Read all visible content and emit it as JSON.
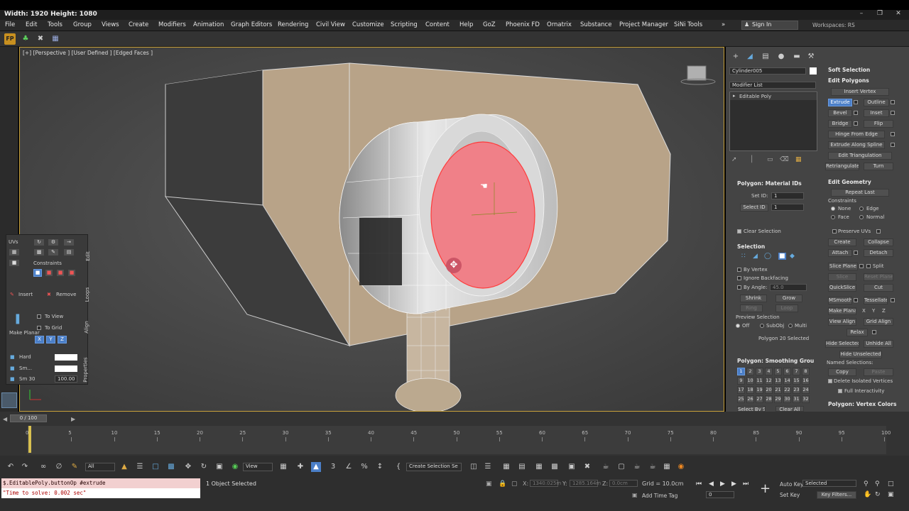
{
  "title_overlay": "Width: 1920  Height: 1080",
  "menu": [
    "File",
    "Edit",
    "Tools",
    "Group",
    "Views",
    "Create",
    "Modifiers",
    "Animation",
    "Graph Editors",
    "Rendering",
    "Civil View",
    "Customize",
    "Scripting",
    "Content",
    "Help",
    "GoZ",
    "Phoenix FD",
    "Ornatrix",
    "Substance",
    "Project Manager",
    "SiNi Tools"
  ],
  "sign_in": "Sign In",
  "workspaces": "Workspaces: RS",
  "viewport_label": "[+] [Perspective ] [User Defined ] [Edged Faces ]",
  "object_name": "Cylinder005",
  "modifier_list": "Modifier List",
  "modifier_stack_item": "Editable Poly",
  "panels": {
    "soft_selection": "Soft Selection",
    "edit_polygons": "Edit Polygons",
    "insert_vertex": "Insert Vertex",
    "extrude": "Extrude",
    "outline": "Outline",
    "bevel": "Bevel",
    "inset": "Inset",
    "bridge": "Bridge",
    "flip": "Flip",
    "hinge": "Hinge From Edge",
    "extrude_spline": "Extrude Along Spline",
    "edit_triangulation": "Edit Triangulation",
    "retriangulate": "Retriangulate",
    "turn": "Turn",
    "edit_geometry": "Edit Geometry",
    "repeat_last": "Repeat Last",
    "constraints": "Constraints",
    "none": "None",
    "edge": "Edge",
    "face": "Face",
    "normal": "Normal",
    "preserve_uvs": "Preserve UVs",
    "create": "Create",
    "collapse": "Collapse",
    "attach": "Attach",
    "detach": "Detach",
    "slice_plane": "Slice Plane",
    "split": "Split",
    "slice": "Slice",
    "reset_plane": "Reset Plane",
    "quickslice": "QuickSlice",
    "cut": "Cut",
    "msmooth": "MSmooth",
    "tessellate": "Tessellate",
    "make_planar": "Make Planar",
    "x": "X",
    "y": "Y",
    "z": "Z",
    "view_align": "View Align",
    "grid_align": "Grid Align",
    "relax": "Relax",
    "hide_selected": "Hide Selected",
    "unhide_all": "Unhide All",
    "hide_unselected": "Hide Unselected",
    "named_selections": "Named Selections:",
    "copy": "Copy",
    "paste": "Paste",
    "delete_isolated": "Delete Isolated Vertices",
    "full_interactivity": "Full Interactivity",
    "vertex_colors": "Polygon: Vertex Colors",
    "material_ids": "Polygon: Material IDs",
    "set_id": "Set ID:",
    "select_id": "Select ID",
    "set_id_val": "1",
    "select_id_val": "1",
    "clear_selection": "Clear Selection",
    "selection": "Selection",
    "by_vertex": "By Vertex",
    "ignore_backfacing": "Ignore Backfacing",
    "by_angle": "By Angle:",
    "by_angle_val": "45.0",
    "shrink": "Shrink",
    "grow": "Grow",
    "ring": "Ring",
    "loop": "Loop",
    "preview_selection": "Preview Selection",
    "off": "Off",
    "subobj": "SubObj",
    "multi": "Multi",
    "poly_selected": "Polygon 20 Selected",
    "smoothing_groups": "Polygon: Smoothing Grou",
    "sg_numbers": [
      "1",
      "2",
      "3",
      "4",
      "5",
      "6",
      "7",
      "8",
      "9",
      "10",
      "11",
      "12",
      "13",
      "14",
      "15",
      "16",
      "17",
      "18",
      "19",
      "20",
      "21",
      "22",
      "23",
      "24",
      "25",
      "26",
      "27",
      "28",
      "29",
      "30",
      "31",
      "32"
    ],
    "select_by_sg": "Select By SG",
    "clear_all": "Clear All"
  },
  "float_panel": {
    "uvs": "UVs",
    "constraints": "Constraints",
    "edit": "Edit",
    "insert": "Insert",
    "remove": "Remove",
    "loops": "Loops",
    "to_view": "To View",
    "to_grid": "To Grid",
    "make_planar": "Make Planar",
    "align": "Align",
    "x": "X",
    "y": "Y",
    "z": "Z",
    "hard": "Hard",
    "smooth": "Sm...",
    "sm30": "Sm 30",
    "sm30_val": "100.00",
    "properties": "Properties"
  },
  "time_slider": "0 / 100",
  "ruler_ticks": [
    "0",
    "5",
    "10",
    "15",
    "20",
    "25",
    "30",
    "35",
    "40",
    "45",
    "50",
    "55",
    "60",
    "65",
    "70",
    "75",
    "80",
    "85",
    "90",
    "95",
    "100"
  ],
  "toolbar": {
    "all": "All",
    "view": "View",
    "create_selection_set": "Create Selection Se"
  },
  "maxscript_line1": "$.EditablePoly.buttonOp #extrude",
  "maxscript_line2": "\"Time to solve: 0.002 sec\"",
  "status_text": "1 Object Selected",
  "coords": {
    "x_label": "X:",
    "x_val": "1340.025m",
    "y_label": "Y:",
    "y_val": "1285.164m",
    "z_label": "Z:",
    "z_val": "0.0cm"
  },
  "grid": "Grid = 10.0cm",
  "add_time_tag": "Add Time Tag",
  "auto_key": "Auto Key",
  "set_key": "Set Key",
  "selected": "Selected",
  "key_filters": "Key Filters...",
  "frame": "0",
  "colors": {
    "accent": "#4b7fc8",
    "selected_poly": "#f08088",
    "wall": "#b8a388",
    "viewport_bg": "#4b4b4b"
  }
}
